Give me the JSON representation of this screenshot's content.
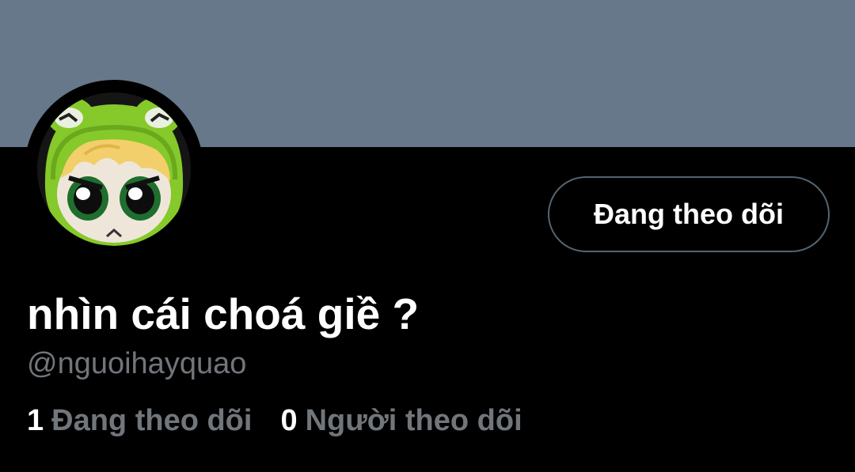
{
  "banner": {
    "color": "#66788a"
  },
  "avatar": {
    "icon": "frog-hood-plush-avatar"
  },
  "follow_button": {
    "label": "Đang theo dõi"
  },
  "profile": {
    "display_name": "nhìn cái choá giề ?",
    "handle": "@nguoihayquao"
  },
  "stats": {
    "following_count": "1",
    "following_label": "Đang theo dõi",
    "followers_count": "0",
    "followers_label": "Người theo dõi"
  },
  "colors": {
    "background": "#000000",
    "primary_text": "#ffffff",
    "secondary_text": "#71767b",
    "button_border": "#536471"
  }
}
